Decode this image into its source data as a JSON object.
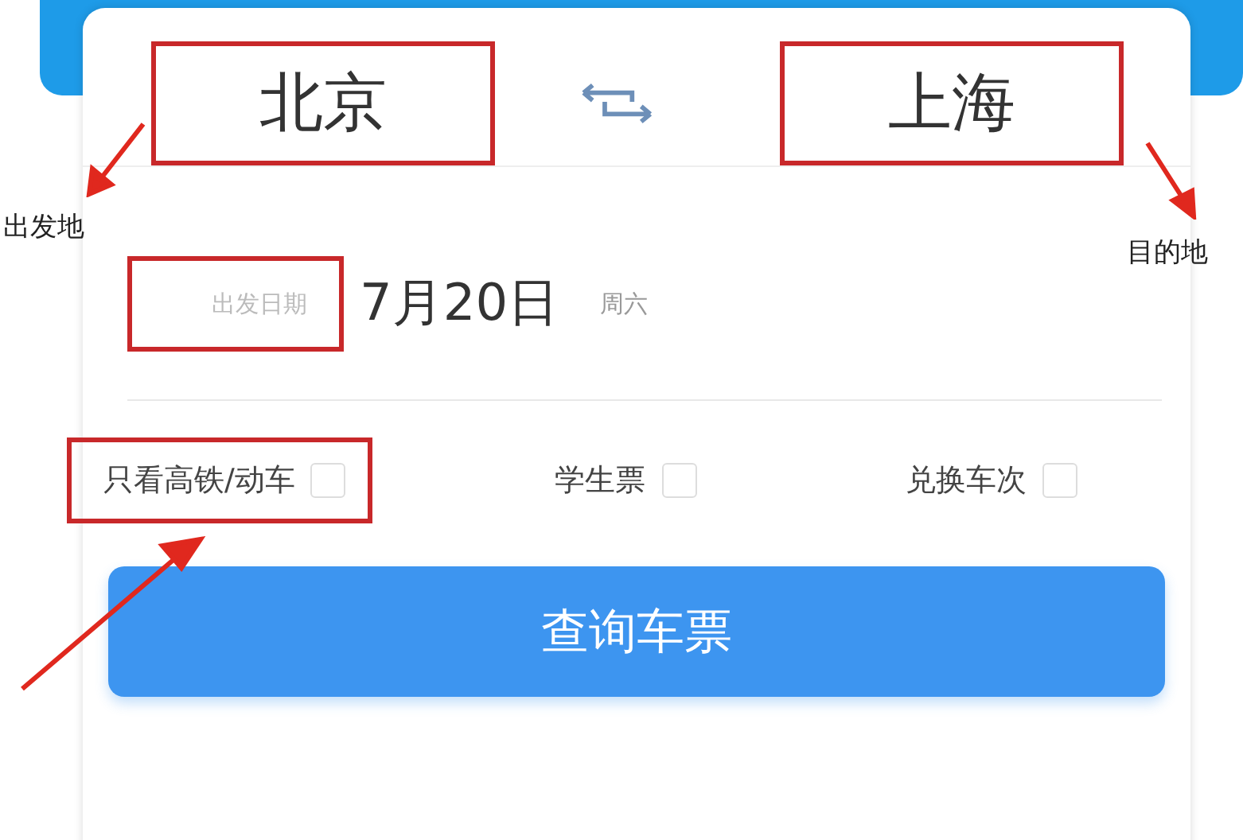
{
  "route": {
    "from": "北京",
    "to": "上海"
  },
  "date": {
    "label": "出发日期",
    "value": "7月20日",
    "weekday": "周六"
  },
  "options": [
    {
      "label": "只看高铁/动车",
      "checked": false,
      "highlighted": true
    },
    {
      "label": "学生票",
      "checked": false,
      "highlighted": false
    },
    {
      "label": "兑换车次",
      "checked": false,
      "highlighted": false
    }
  ],
  "search_button": "查询车票",
  "annotations": [
    {
      "text": "出发地"
    },
    {
      "text": "目的地"
    }
  ]
}
